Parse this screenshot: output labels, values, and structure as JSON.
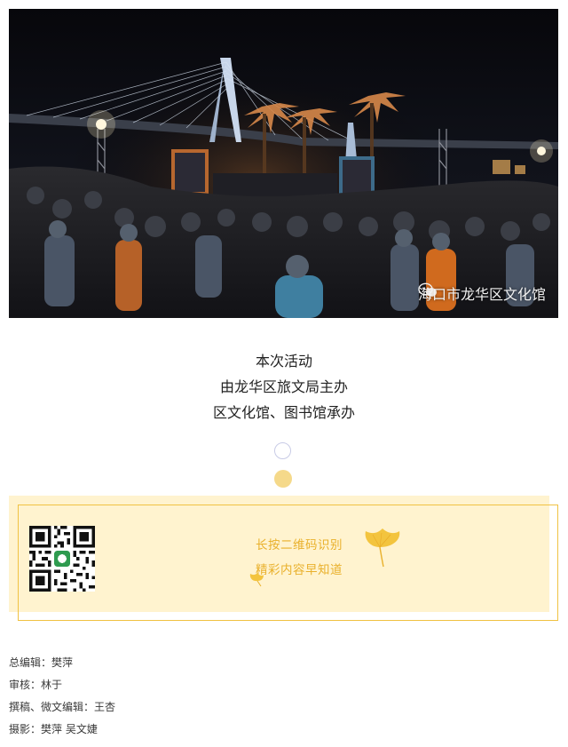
{
  "photo": {
    "watermark_text": "海口市龙华区文化馆",
    "watermark_icon": "wechat-icon"
  },
  "caption": {
    "line1": "本次活动",
    "line2": "由龙华区旅文局主办",
    "line3": "区文化馆、图书馆承办"
  },
  "qr_panel": {
    "line1": "长按二维码识别",
    "line2": "精彩内容早知道",
    "accent_color": "#e9b02b",
    "background_color": "#fff3cf"
  },
  "credits": [
    "总编辑：樊萍",
    "审核：林于",
    "撰稿、微文编辑：王杏",
    "摄影：樊萍 吴文婕"
  ]
}
